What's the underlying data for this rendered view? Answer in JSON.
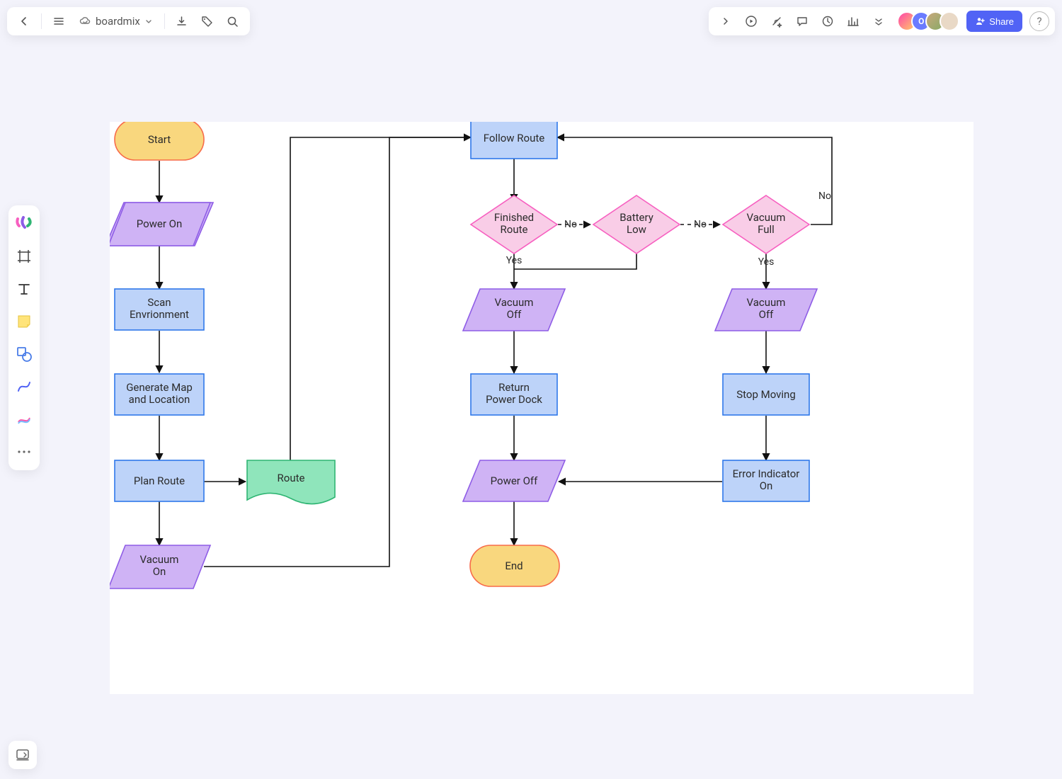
{
  "app": {
    "name": "boardmix",
    "share_label": "Share"
  },
  "avatars": [
    {
      "initial": "",
      "bg": "linear-gradient(135deg,#f0b,#fb0)"
    },
    {
      "initial": "O",
      "bg": "#6a7bff"
    },
    {
      "initial": "",
      "bg": "#c9a87c"
    },
    {
      "initial": "",
      "bg": "#e9d9c6"
    }
  ],
  "nodes": {
    "start": "Start",
    "power_on": "Power On",
    "scan_env": "Scan\nEnvrionment",
    "gen_map": "Generate Map\nand Location",
    "plan_route": "Plan Route",
    "route_doc": "Route",
    "vacuum_on": "Vacuum\nOn",
    "follow_route": "Follow Route",
    "finished_route": "Finished\nRoute",
    "battery_low": "Battery\nLow",
    "vacuum_full": "Vacuum\nFull",
    "vacuum_off_left": "Vacuum\nOff",
    "vacuum_off_right": "Vacuum\nOff",
    "return_dock": "Return\nPower Dock",
    "stop_moving": "Stop Moving",
    "error_ind": "Error Indicator\nOn",
    "power_off": "Power Off",
    "end": "End"
  },
  "edges": {
    "yes": "Yes",
    "no": "No"
  }
}
